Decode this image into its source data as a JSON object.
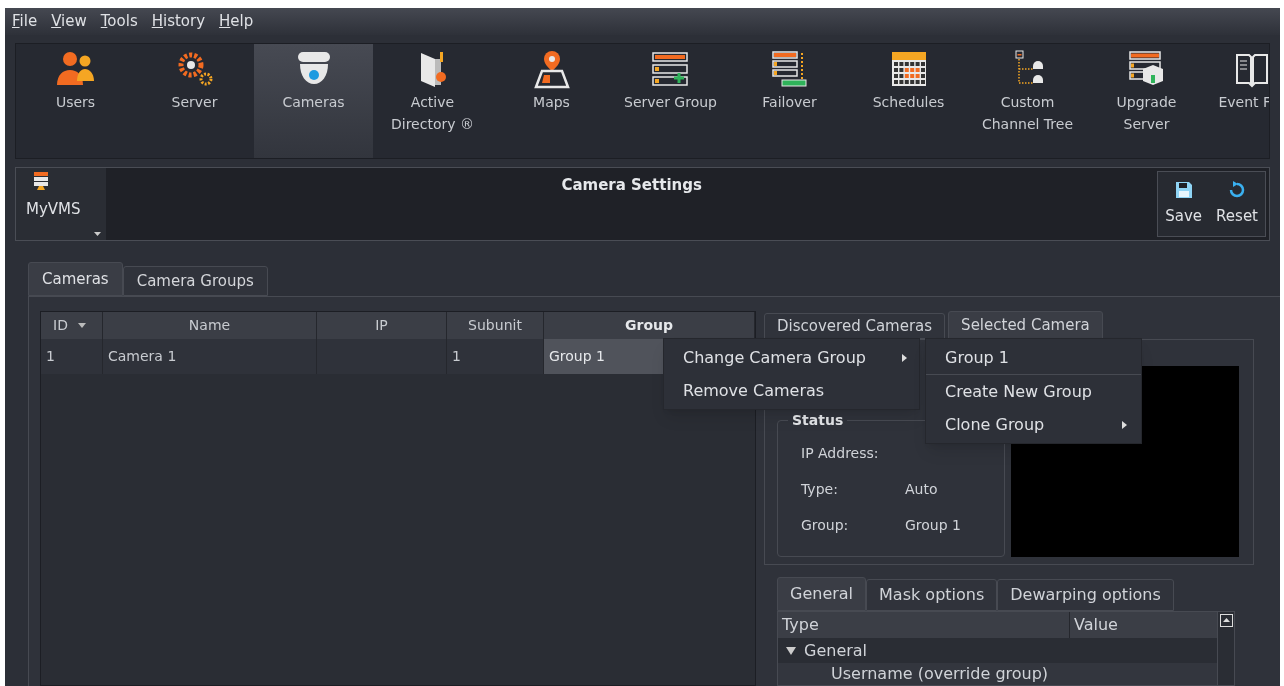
{
  "menu_bar": [
    "File",
    "View",
    "Tools",
    "History",
    "Help"
  ],
  "toolbar": [
    {
      "label": "Users",
      "kind": "users",
      "selected": false
    },
    {
      "label": "Server",
      "kind": "server",
      "selected": false
    },
    {
      "label": "Cameras",
      "kind": "camera",
      "selected": true
    },
    {
      "label": "Active\nDirectory ®",
      "kind": "directory",
      "selected": false
    },
    {
      "label": "Maps",
      "kind": "map",
      "selected": false
    },
    {
      "label": "Server Group",
      "kind": "server-group",
      "selected": false
    },
    {
      "label": "Failover",
      "kind": "failover",
      "selected": false
    },
    {
      "label": "Schedules",
      "kind": "schedule",
      "selected": false
    },
    {
      "label": "Custom\nChannel Tree",
      "kind": "tree",
      "selected": false
    },
    {
      "label": "Upgrade\nServer",
      "kind": "upgrade",
      "selected": false
    },
    {
      "label": "Event F",
      "kind": "event",
      "selected": false
    }
  ],
  "header": {
    "server": "MyVMS",
    "title": "Camera Settings",
    "actions": [
      {
        "label": "Save",
        "kind": "save"
      },
      {
        "label": "Reset",
        "kind": "reset"
      }
    ]
  },
  "tabs": [
    {
      "label": "Cameras",
      "selected": true
    },
    {
      "label": "Camera Groups",
      "selected": false
    }
  ],
  "table": {
    "columns": [
      {
        "label": "ID",
        "sort_indicator": true,
        "emphasized": false
      },
      {
        "label": "Name",
        "sort_indicator": false,
        "emphasized": false
      },
      {
        "label": "IP",
        "sort_indicator": false,
        "emphasized": false
      },
      {
        "label": "Subunit",
        "sort_indicator": false,
        "emphasized": false
      },
      {
        "label": "Group",
        "sort_indicator": false,
        "emphasized": true
      }
    ],
    "rows": [
      {
        "cells": [
          {
            "text": "1",
            "selected": false
          },
          {
            "text": "Camera 1",
            "selected": false
          },
          {
            "selected": false
          },
          {
            "text": "1",
            "selected": false
          },
          {
            "text": "Group 1",
            "selected": true
          }
        ]
      }
    ]
  },
  "context_menu": [
    {
      "label": "Change Camera Group",
      "submenu": true
    },
    {
      "label": "Remove Cameras",
      "submenu": false
    }
  ],
  "submenu": [
    {
      "label": "Group 1",
      "submenu": false,
      "separator_after": true
    },
    {
      "label": "Create New Group",
      "submenu": false,
      "separator_after": false
    },
    {
      "label": "Clone Group",
      "submenu": true,
      "separator_after": false
    }
  ],
  "side_tabs": [
    {
      "label": "Discovered Cameras",
      "selected": false
    },
    {
      "label": "Selected Camera",
      "selected": true
    }
  ],
  "status": {
    "title": "Status",
    "rows": [
      {
        "label": "IP Address:"
      },
      {
        "label": "Type:",
        "value": "Auto"
      },
      {
        "label": "Group:",
        "value": "Group 1"
      }
    ]
  },
  "detail_tabs": [
    {
      "label": "General",
      "selected": true
    },
    {
      "label": "Mask options",
      "selected": false
    },
    {
      "label": "Dewarping options",
      "selected": false
    }
  ],
  "properties": {
    "columns": [
      "Type",
      "Value"
    ],
    "rows": [
      {
        "label": "General",
        "expanded": true,
        "children": [
          {
            "label": "Username (override group)"
          }
        ]
      }
    ]
  }
}
